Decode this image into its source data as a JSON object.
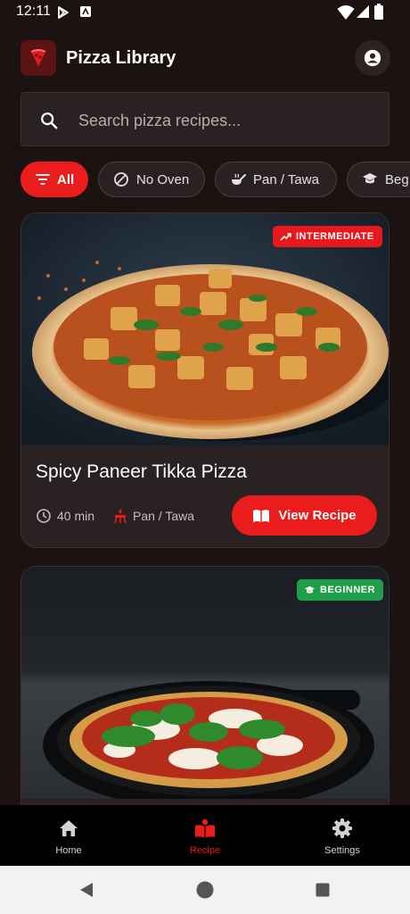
{
  "status_bar": {
    "time": "12:11"
  },
  "app": {
    "title": "Pizza Library"
  },
  "search": {
    "placeholder": "Search pizza recipes..."
  },
  "chips": [
    {
      "label": "All",
      "icon": "filter-icon",
      "active": true
    },
    {
      "label": "No Oven",
      "icon": "block-icon",
      "active": false
    },
    {
      "label": "Pan / Tawa",
      "icon": "pan-icon",
      "active": false
    },
    {
      "label": "Beg",
      "icon": "school-icon",
      "active": false
    }
  ],
  "recipes": [
    {
      "title": "Spicy Paneer Tikka Pizza",
      "level": "INTERMEDIATE",
      "level_color": "#e8191c",
      "time": "40 min",
      "method": "Pan / Tawa",
      "button": "View Recipe"
    },
    {
      "level": "BEGINNER",
      "level_color": "#1f9e4a"
    }
  ],
  "bottom_nav": [
    {
      "label": "Home",
      "icon": "home-icon",
      "active": false
    },
    {
      "label": "Recipe",
      "icon": "recipe-book-icon",
      "active": true
    },
    {
      "label": "Settings",
      "icon": "gear-icon",
      "active": false
    }
  ],
  "colors": {
    "accent": "#ea1c1c",
    "background": "#1d1212",
    "card": "#2a2222",
    "beginner": "#1f9e4a"
  }
}
